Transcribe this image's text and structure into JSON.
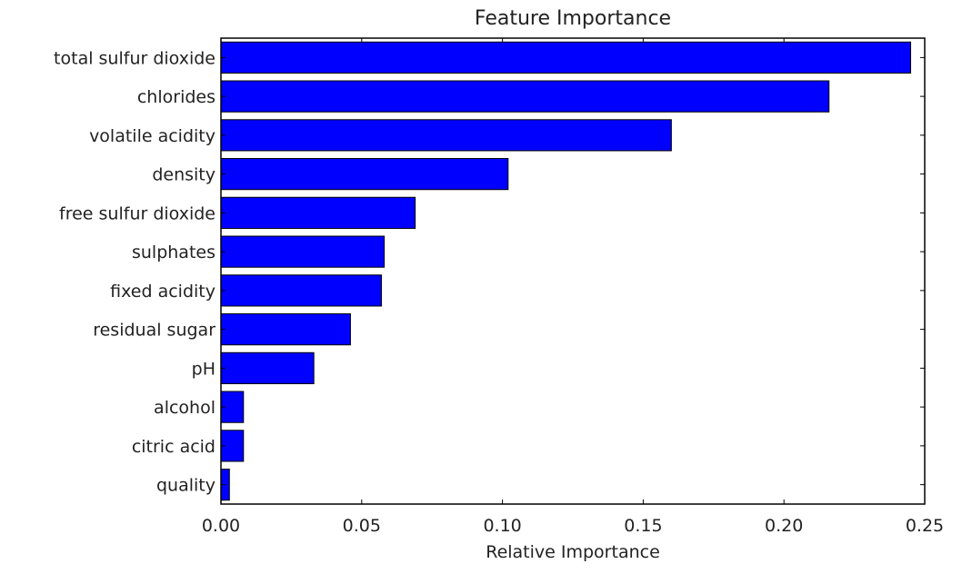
{
  "chart_data": {
    "type": "bar",
    "orientation": "horizontal",
    "title": "Feature Importance",
    "xlabel": "Relative Importance",
    "ylabel": "",
    "xlim": [
      0,
      0.25
    ],
    "xticks": [
      "0.00",
      "0.05",
      "0.10",
      "0.15",
      "0.20",
      "0.25"
    ],
    "xtick_values": [
      0,
      0.05,
      0.1,
      0.15,
      0.2,
      0.25
    ],
    "grid": false,
    "bar_color": "#0000ff",
    "edge_color": "#000000",
    "categories": [
      "total sulfur dioxide",
      "chlorides",
      "volatile acidity",
      "density",
      "free sulfur dioxide",
      "sulphates",
      "fixed acidity",
      "residual sugar",
      "pH",
      "alcohol",
      "citric acid",
      "quality"
    ],
    "values": [
      0.245,
      0.216,
      0.16,
      0.102,
      0.069,
      0.058,
      0.057,
      0.046,
      0.033,
      0.008,
      0.008,
      0.003
    ]
  }
}
